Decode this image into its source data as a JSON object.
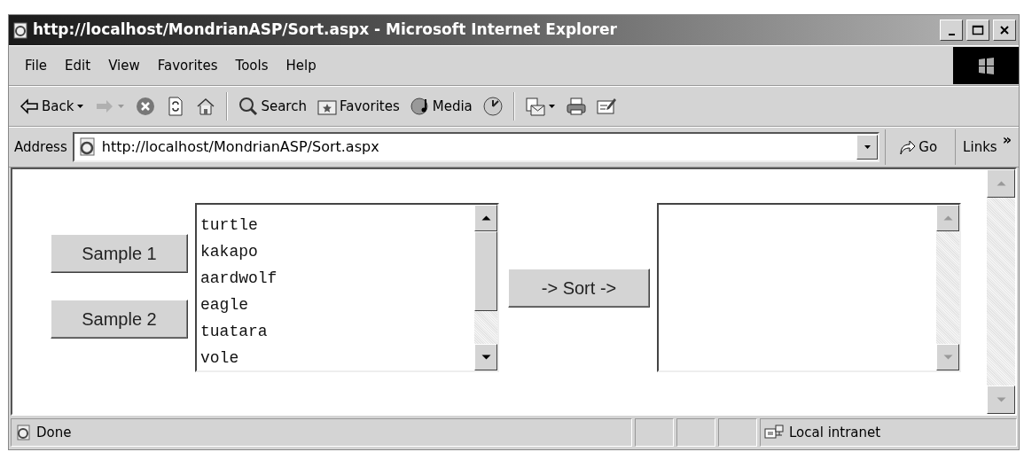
{
  "window": {
    "title": "http://localhost/MondrianASP/Sort.aspx - Microsoft Internet Explorer"
  },
  "menu": [
    "File",
    "Edit",
    "View",
    "Favorites",
    "Tools",
    "Help"
  ],
  "toolbar": [
    {
      "kind": "back",
      "label": "Back",
      "dropdown": true,
      "disabled": false
    },
    {
      "kind": "forward",
      "dropdown": true,
      "disabled": true
    },
    {
      "kind": "stop",
      "disabled": false
    },
    {
      "kind": "refresh",
      "disabled": false
    },
    {
      "kind": "home",
      "disabled": false
    },
    {
      "kind": "separator"
    },
    {
      "kind": "search",
      "label": "Search",
      "disabled": false
    },
    {
      "kind": "favorites",
      "label": "Favorites",
      "disabled": false
    },
    {
      "kind": "media",
      "label": "Media",
      "disabled": false
    },
    {
      "kind": "history",
      "disabled": false
    },
    {
      "kind": "separator"
    },
    {
      "kind": "mail",
      "dropdown": true,
      "disabled": false
    },
    {
      "kind": "print",
      "disabled": false
    },
    {
      "kind": "edit",
      "disabled": false
    }
  ],
  "address": {
    "label": "Address",
    "value": "http://localhost/MondrianASP/Sort.aspx",
    "go": "Go",
    "links": "Links",
    "links_more": "»"
  },
  "page": {
    "buttons": [
      {
        "label": "Sample 1"
      },
      {
        "label": "Sample 2"
      }
    ],
    "source_list": {
      "scrollable": true,
      "items": [
        "turtle",
        "kakapo",
        "aardwolf",
        "eagle",
        "tuatara",
        "vole"
      ]
    },
    "sort_button": "-> Sort ->",
    "target_list": {
      "scrollable": false
    }
  },
  "status_bar": {
    "text": "Done",
    "zone": "Local intranet"
  }
}
